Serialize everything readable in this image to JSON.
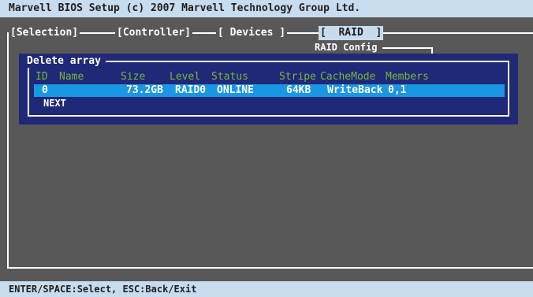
{
  "window": {
    "title": "Marvell BIOS Setup (c) 2007 Marvell Technology Group Ltd."
  },
  "menu": [
    {
      "label": "[Selection]"
    },
    {
      "label": "[Controller]"
    },
    {
      "label": "[ Devices ]"
    },
    {
      "label": "[  RAID  ]"
    }
  ],
  "submenu": {
    "label": "RAID Config"
  },
  "dialog": {
    "title": "Delete array",
    "columns": [
      "ID",
      "Name",
      "Size",
      "Level",
      "Status",
      "Stripe",
      "CacheMode",
      "Members"
    ],
    "rows": [
      {
        "id": "0",
        "name": "",
        "size": "73.2GB",
        "level": "RAID0",
        "status": "ONLINE",
        "stripe": "64KB",
        "cache": "WriteBack",
        "members": "0,1"
      }
    ],
    "next_label": "NEXT"
  },
  "status_bar": {
    "help": "ENTER/SPACE:Select, ESC:Back/Exit"
  },
  "colors": {
    "bar_bg": "#c7dcee",
    "screen_bg": "#585858",
    "dialog_bg": "#202878",
    "header_text": "#79b83a",
    "selection_bg": "#1a97e3"
  }
}
